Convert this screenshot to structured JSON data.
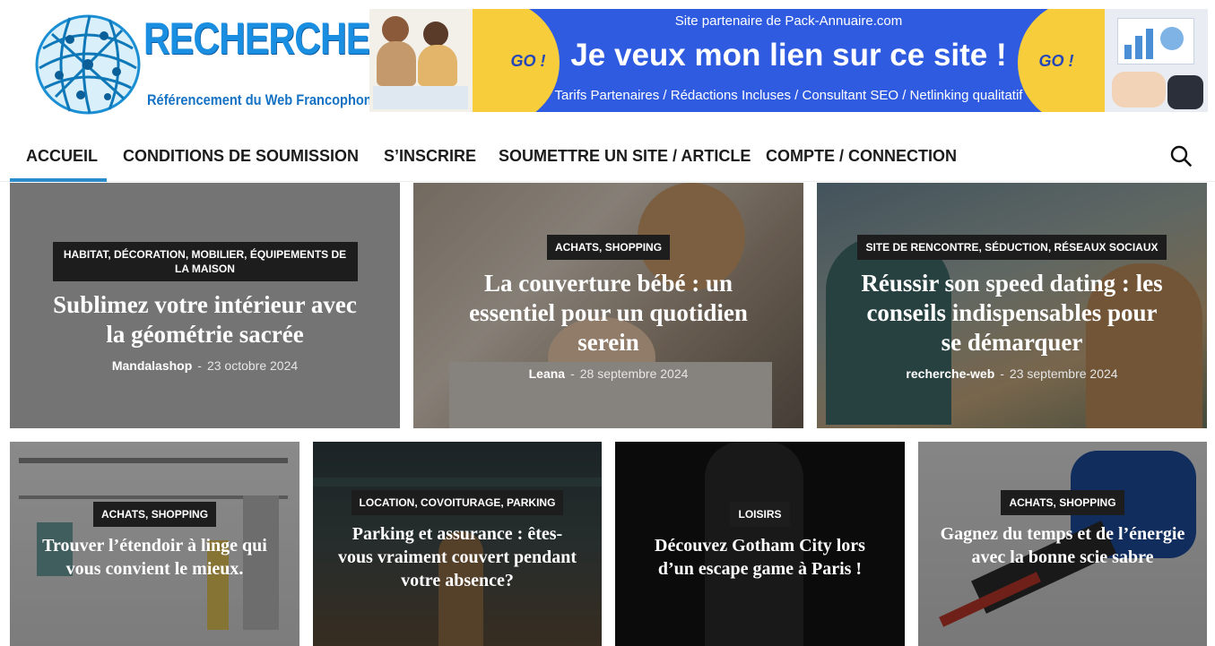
{
  "logo": {
    "title": "RECHERCHE WEB",
    "subtitle": "Référencement du Web Francophone"
  },
  "banner": {
    "top_text": "Site partenaire de Pack-Annuaire.com",
    "main_text": "Je veux mon lien sur ce site !",
    "go_label": "GO !",
    "bottom_text": "Tarifs Partenaires / Rédactions Incluses / Consultant SEO / Netlinking qualitatif"
  },
  "nav": {
    "items": [
      {
        "label": "ACCUEIL",
        "active": true
      },
      {
        "label": "CONDITIONS DE SOUMISSION"
      },
      {
        "label": "S’INSCRIRE"
      },
      {
        "label": "SOUMETTRE UN SITE / ARTICLE"
      },
      {
        "label": "COMPTE / CONNECTION"
      }
    ],
    "search_icon": "search-icon",
    "accent_color": "#2b8ccb"
  },
  "featured": [
    {
      "category": "HABITAT, DÉCORATION, MOBILIER, ÉQUIPEMENTS DE LA MAISON",
      "title": "Sublimez votre intérieur avec la géométrie sacrée",
      "author": "Mandalashop",
      "date": "23 octobre 2024"
    },
    {
      "category": "ACHATS, SHOPPING",
      "title": "La couverture bébé : un essentiel pour un quotidien serein",
      "author": "Leana",
      "date": "28 septembre 2024"
    },
    {
      "category": "SITE DE RENCONTRE, SÉDUCTION, RÉSEAUX SOCIAUX",
      "title": "Réussir son speed dating : les conseils indispensables pour se démarquer",
      "author": "recherche-web",
      "date": "23 septembre 2024"
    }
  ],
  "secondary": [
    {
      "category": "ACHATS, SHOPPING",
      "title": "Trouver l’étendoir à linge qui vous convient le mieux."
    },
    {
      "category": "LOCATION, COVOITURAGE, PARKING",
      "title": "Parking et assurance : êtes-vous vraiment couvert pendant votre absence?"
    },
    {
      "category": "LOISIRS",
      "title": "Découvez Gotham City lors d’un escape game à Paris !"
    },
    {
      "category": "ACHATS, SHOPPING",
      "title": "Gagnez du temps et de l’énergie avec la bonne scie sabre"
    }
  ],
  "meta_separator": "-"
}
